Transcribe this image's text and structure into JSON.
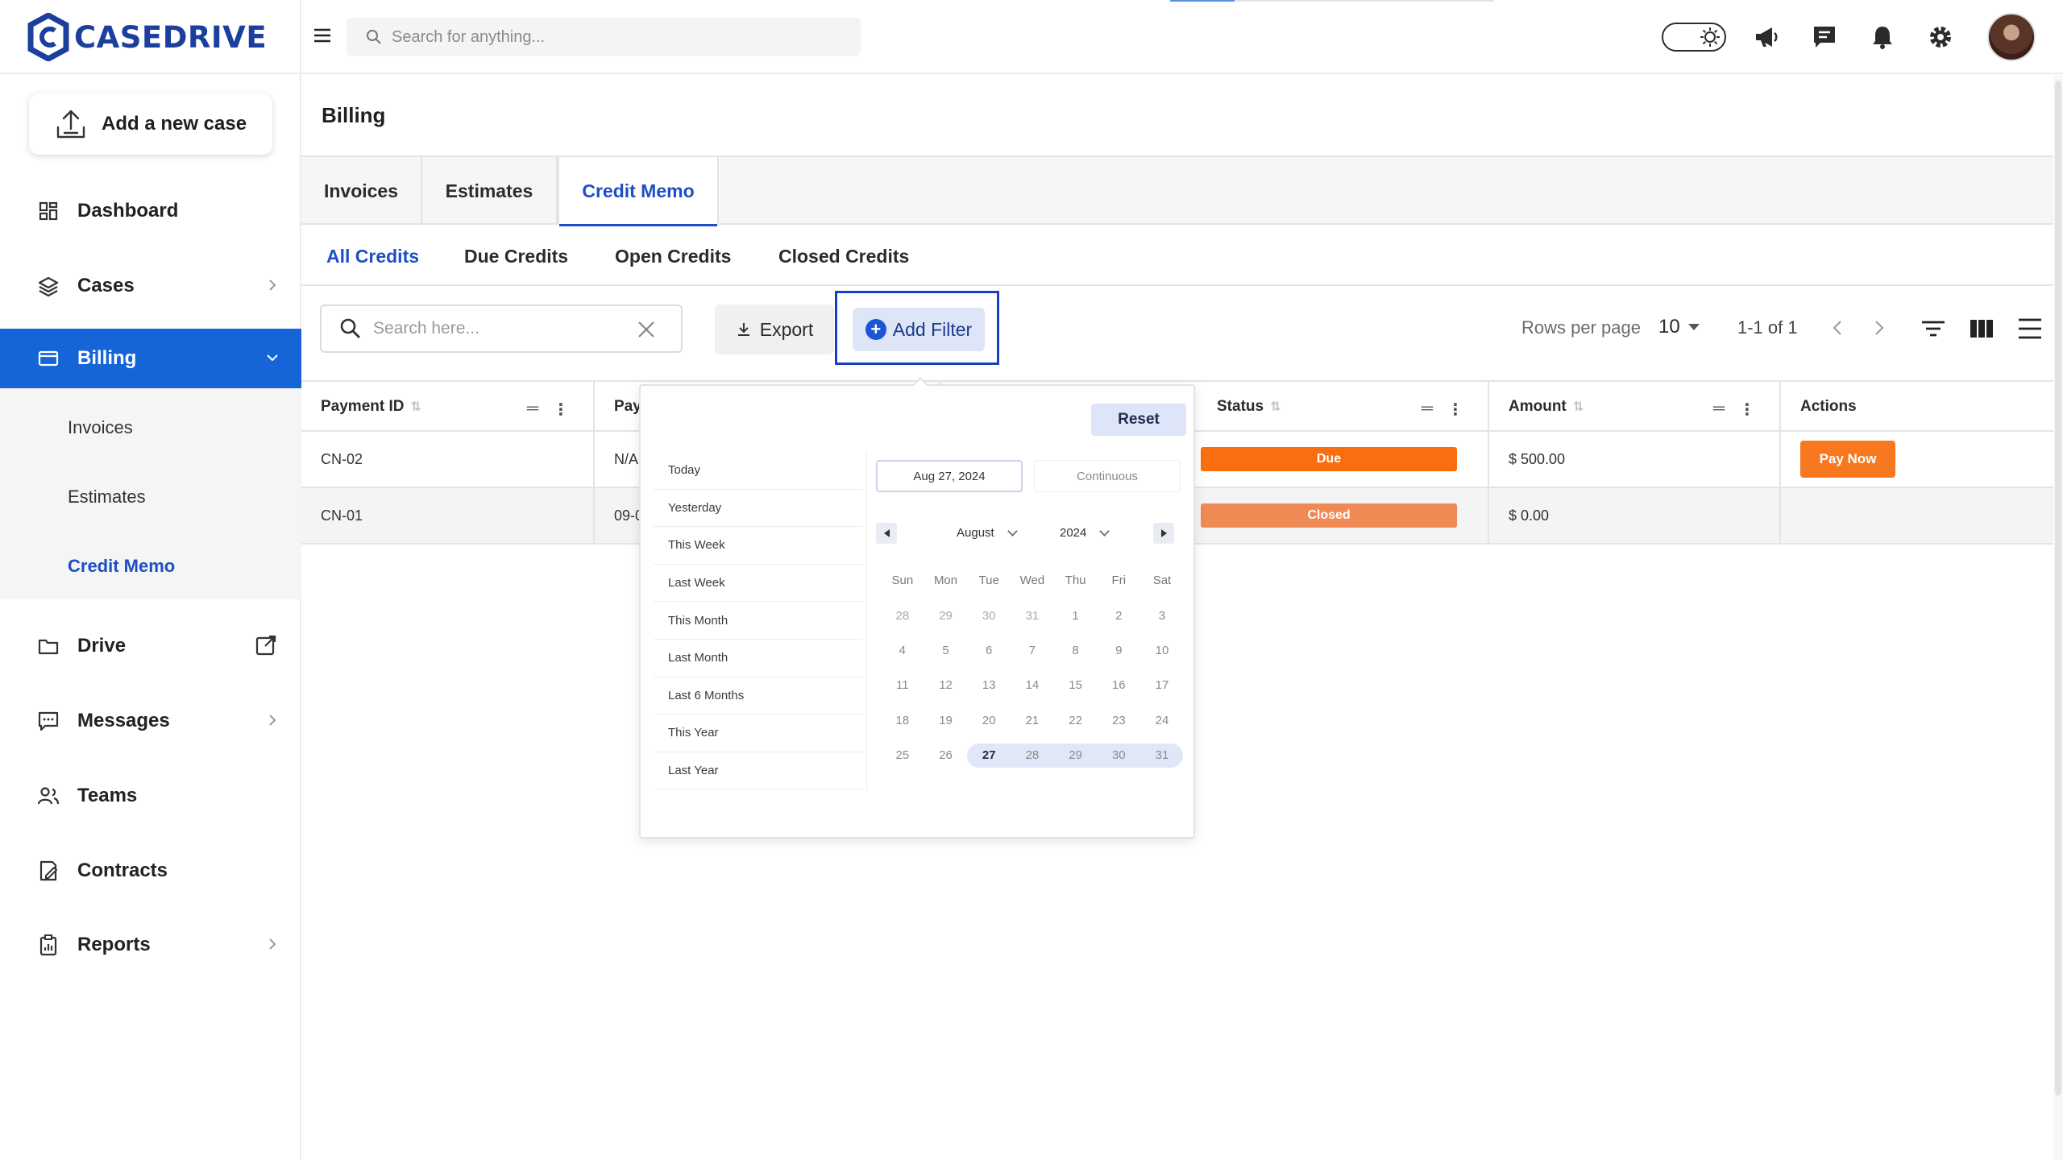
{
  "brand": {
    "name": "CASEDRIVE",
    "color": "#1c3f9e"
  },
  "colors": {
    "accent": "#1565d8",
    "due": "#f96e0f",
    "closed": "#ef8a55",
    "pay": "#f7781e"
  },
  "topbar": {
    "search_placeholder": "Search for anything...",
    "icons": [
      "menu-icon",
      "search-icon",
      "theme-toggle",
      "megaphone-icon",
      "chat-icon",
      "bell-icon",
      "gear-icon",
      "avatar"
    ]
  },
  "sidebar": {
    "new_case_label": "Add a new case",
    "items": [
      {
        "label": "Dashboard",
        "icon": "dashboard-icon"
      },
      {
        "label": "Cases",
        "icon": "layers-icon"
      },
      {
        "label": "Billing",
        "icon": "card-icon",
        "active": true
      },
      {
        "label": "Drive",
        "icon": "folder-icon"
      },
      {
        "label": "Messages",
        "icon": "messages-icon"
      },
      {
        "label": "Teams",
        "icon": "teams-icon"
      },
      {
        "label": "Contracts",
        "icon": "contract-icon"
      },
      {
        "label": "Reports",
        "icon": "reports-icon"
      }
    ],
    "billing_sub": [
      "Invoices",
      "Estimates",
      "Credit Memo"
    ]
  },
  "page": {
    "title": "Billing"
  },
  "tabs": [
    "Invoices",
    "Estimates",
    "Credit Memo"
  ],
  "subtabs": [
    "All Credits",
    "Due Credits",
    "Open Credits",
    "Closed Credits"
  ],
  "toolbar": {
    "search_placeholder": "Search here...",
    "export_label": "Export",
    "add_filter_label": "Add Filter",
    "rows_per_page_label": "Rows per page",
    "rows_per_page_value": "10",
    "range_text": "1-1 of 1"
  },
  "table": {
    "headers": {
      "payment_id": "Payment ID",
      "pay": "Pay",
      "status": "Status",
      "amount": "Amount",
      "actions": "Actions"
    },
    "rows": [
      {
        "payment_id": "CN-02",
        "pay": "N/A",
        "status": "Due",
        "amount": "$ 500.00",
        "action": "Pay Now"
      },
      {
        "payment_id": "CN-01",
        "pay": "09-0",
        "status": "Closed",
        "amount": "$ 0.00",
        "action": ""
      }
    ]
  },
  "datepicker": {
    "reset_label": "Reset",
    "presets": [
      "Today",
      "Yesterday",
      "This Week",
      "Last Week",
      "This Month",
      "Last Month",
      "Last 6 Months",
      "This Year",
      "Last Year"
    ],
    "start_date": "Aug 27, 2024",
    "end_date": "Continuous",
    "month": "August",
    "year": "2024",
    "weekdays": [
      "Sun",
      "Mon",
      "Tue",
      "Wed",
      "Thu",
      "Fri",
      "Sat"
    ],
    "weeks": [
      [
        "28",
        "29",
        "30",
        "31",
        "1",
        "2",
        "3"
      ],
      [
        "4",
        "5",
        "6",
        "7",
        "8",
        "9",
        "10"
      ],
      [
        "11",
        "12",
        "13",
        "14",
        "15",
        "16",
        "17"
      ],
      [
        "18",
        "19",
        "20",
        "21",
        "22",
        "23",
        "24"
      ],
      [
        "25",
        "26",
        "27",
        "28",
        "29",
        "30",
        "31"
      ]
    ],
    "selected_day": "27"
  }
}
